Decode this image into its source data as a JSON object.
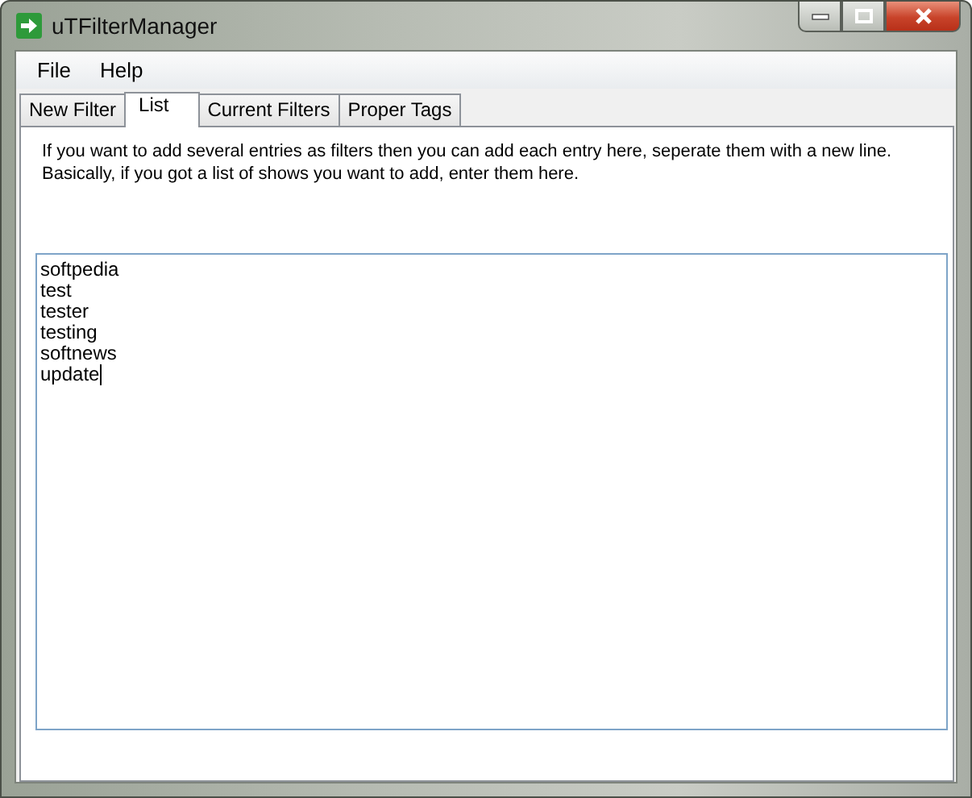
{
  "window": {
    "title": "uTFilterManager"
  },
  "menu": [
    "File",
    "Help"
  ],
  "tabs": [
    {
      "label": "New Filter",
      "selected": false
    },
    {
      "label": "List",
      "selected": true
    },
    {
      "label": "Current Filters",
      "selected": false
    },
    {
      "label": "Proper Tags",
      "selected": false
    }
  ],
  "instructions": [
    "If you want to add several entries as filters then you can add each entry here, seperate them with a new line.",
    "Basically, if you got a list of shows you want to add, enter them here."
  ],
  "list": {
    "lines": [
      "softpedia",
      "test",
      "tester",
      "testing",
      "softnews",
      "update"
    ]
  }
}
